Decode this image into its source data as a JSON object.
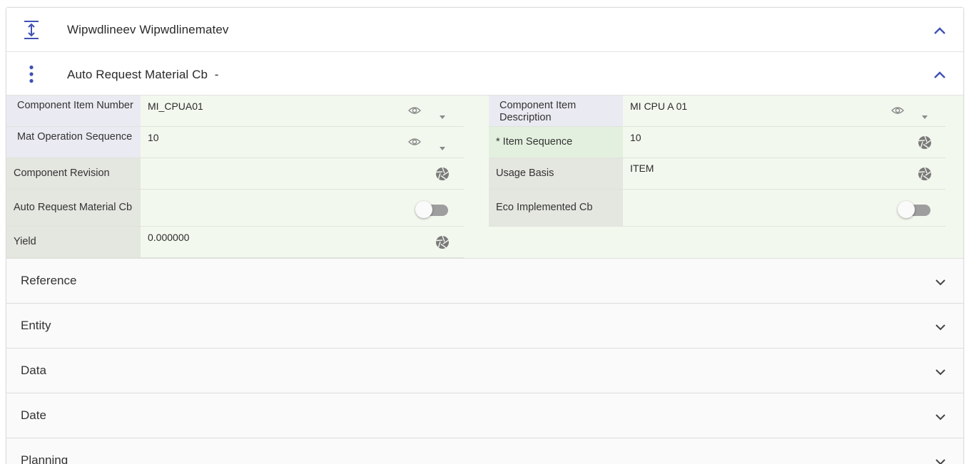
{
  "sections": {
    "header1": {
      "title": "Wipwdlineev Wipwdlinematev",
      "icon": "vertical-align-center-icon"
    },
    "header2": {
      "title": "Auto Request Material Cb",
      "suffix": "-",
      "icon": "more-vert-icon"
    }
  },
  "form": {
    "component_item_number": {
      "label": "Component Item Number",
      "value": "MI_CPUA01"
    },
    "component_item_description": {
      "label": "Component Item Description",
      "value": "MI CPU A 01"
    },
    "mat_operation_sequence": {
      "label": "Mat Operation Sequence",
      "value": "10"
    },
    "item_sequence": {
      "label": "* Item Sequence",
      "value": "10"
    },
    "component_revision": {
      "label": "Component Revision",
      "value": ""
    },
    "usage_basis": {
      "label": "Usage Basis",
      "value": "ITEM"
    },
    "auto_request_material_cb": {
      "label": "Auto Request Material Cb",
      "value": "off"
    },
    "eco_implemented_cb": {
      "label": "Eco Implemented Cb",
      "value": "off"
    },
    "yield": {
      "label": "Yield",
      "value": "0.000000"
    }
  },
  "accordions": [
    {
      "title": "Reference"
    },
    {
      "title": "Entity"
    },
    {
      "title": "Data"
    },
    {
      "title": "Date"
    },
    {
      "title": "Planning"
    }
  ],
  "colors": {
    "accent": "#3f51b5",
    "form_bg": "#f3f8ef",
    "toggle_off": "#9e9e9e"
  }
}
